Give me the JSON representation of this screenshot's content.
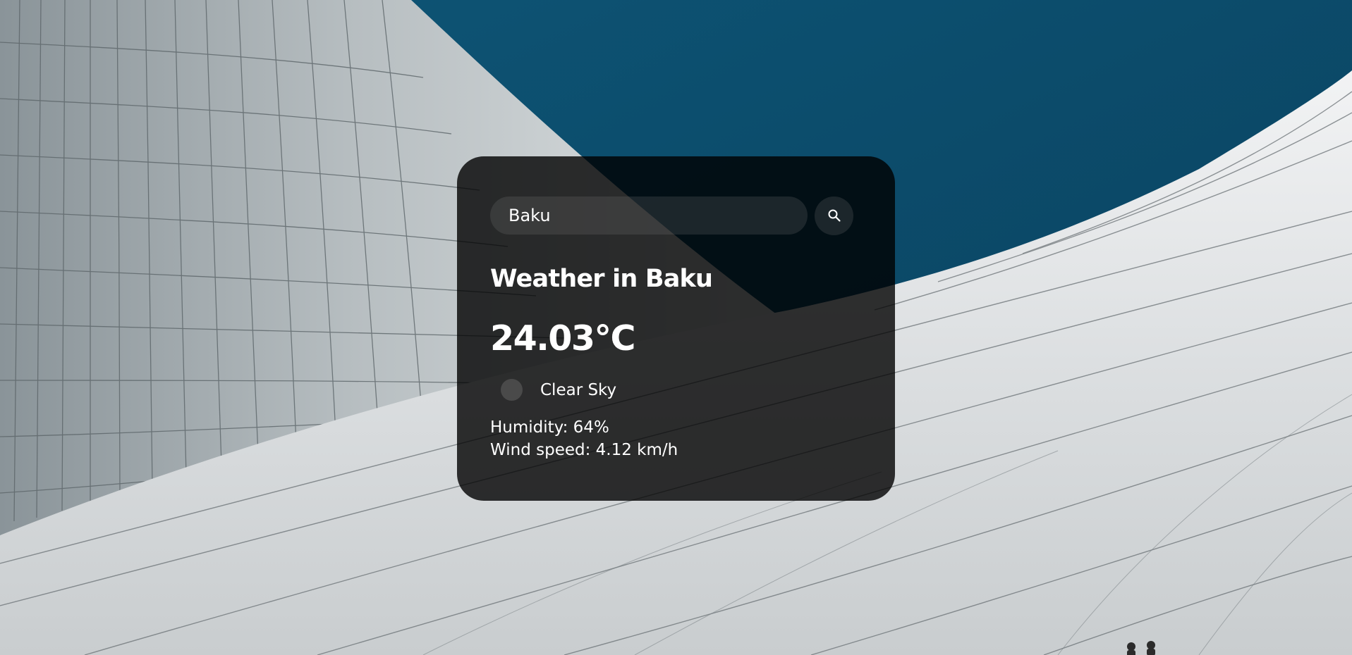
{
  "search": {
    "value": "Baku",
    "button_icon": "search-icon"
  },
  "weather": {
    "city_title": "Weather in Baku",
    "temperature": "24.03°C",
    "description": "Clear Sky",
    "icon": "weather-icon",
    "humidity": "Humidity: 64%",
    "wind_speed": "Wind speed: 4.12 km/h"
  },
  "colors": {
    "sky": "#0c4c6c",
    "card_background": "rgba(0,0,0,0.80)",
    "text": "#ffffff"
  }
}
